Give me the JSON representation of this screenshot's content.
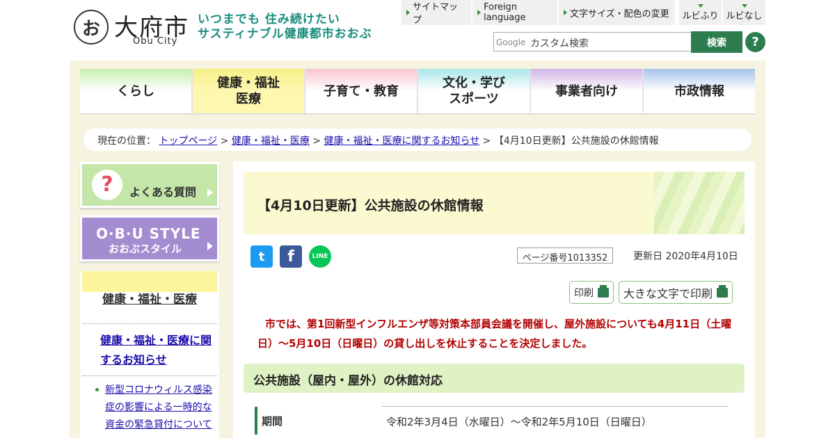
{
  "header": {
    "logo_mark": "お",
    "logo_name": "大府市",
    "logo_sub": "Obu City",
    "tagline_line1": "いつまでも 住み続けたい",
    "tagline_line2": "サスティナブル健康都市おおぶ"
  },
  "util_links": [
    "サイトマップ",
    "Foreign language",
    "文字サイズ・配色の変更"
  ],
  "ruby": {
    "on": "ルビふり",
    "off": "ルビなし"
  },
  "search": {
    "brand": "Google",
    "placeholder": "カスタム検索",
    "button": "検索",
    "help": "?"
  },
  "nav": [
    {
      "label1": "くらし",
      "label2": "",
      "color": "#c9eeb0"
    },
    {
      "label1": "健康・福祉",
      "label2": "医療",
      "color": "#f7f08a"
    },
    {
      "label1": "子育て・教育",
      "label2": "",
      "color": "#f8c4cf"
    },
    {
      "label1": "文化・学び",
      "label2": "スポーツ",
      "color": "#a9e6ea"
    },
    {
      "label1": "事業者向け",
      "label2": "",
      "color": "#d0b5e6"
    },
    {
      "label1": "市政情報",
      "label2": "",
      "color": "#a9c3ec"
    }
  ],
  "breadcrumb": {
    "prefix": "現在の位置：",
    "links": [
      "トップページ",
      "健康・福祉・医療",
      "健康・福祉・医療に関するお知らせ"
    ],
    "sep": ">",
    "current": "【4月10日更新】公共施設の休館情報"
  },
  "sidebar": {
    "faq_label": "よくある質問",
    "faq_mark": "?",
    "obu_line1": "O·B·U STYLE",
    "obu_line2": "おおぶスタイル",
    "heading": "健康・福祉・医療",
    "sub": "健康・福祉・医療に関するお知らせ",
    "items": [
      "新型コロナウィルス感染症の影響による一時的な資金の緊急貸付について"
    ]
  },
  "article": {
    "title": "【4月10日更新】公共施設の休館情報",
    "page_no": "ページ番号1013352",
    "updated": "更新日 2020年4月10日",
    "print": "印刷",
    "print_large": "大きな文字で印刷",
    "notice": "市では、第1回新型インフルエンザ等対策本部員会議を開催し、屋外施設についても4月11日（土曜日）～5月10日（日曜日）の貸し出しを休止することを決定しました。",
    "section_title": "公共施設（屋内・屋外）の休館対応",
    "table": [
      {
        "head": "期間",
        "value": "令和2年3月4日（水曜日）～令和2年5月10日（日曜日）"
      }
    ]
  },
  "sns": {
    "twitter": "t",
    "facebook": "f",
    "line": "LINE"
  }
}
